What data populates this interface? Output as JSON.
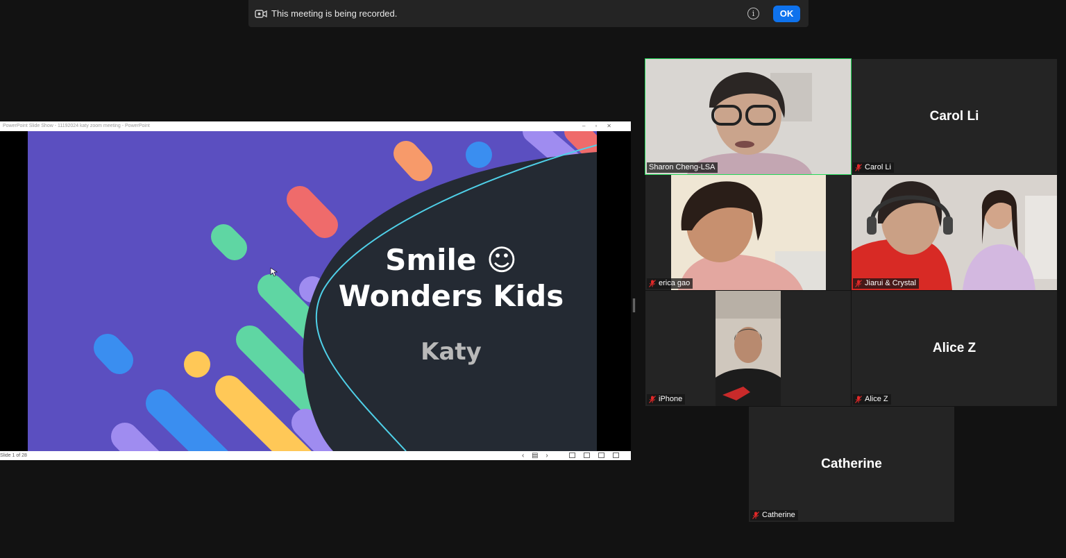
{
  "banner": {
    "message": "This meeting is being recorded.",
    "ok_label": "OK",
    "info_glyph": "i",
    "icon": "record-camera-icon"
  },
  "powerpoint": {
    "window_title": "PowerPoint Slide Show  -  11192024 katy zoom meeting - PowerPoint",
    "slide_counter": "Slide 1 of 28",
    "slide": {
      "title_line1": "Smile ☺",
      "title_line2": "Wonders Kids",
      "subtitle": "Katy"
    }
  },
  "participants": [
    {
      "name": "Sharon Cheng-LSA",
      "video": true,
      "muted": false,
      "speaking": true
    },
    {
      "name": "Carol Li",
      "display_name": "Carol Li",
      "video": false,
      "muted": true
    },
    {
      "name": "erica gao",
      "video": true,
      "muted": true
    },
    {
      "name": "Jiarui & Crystal",
      "video": true,
      "muted": true
    },
    {
      "name": "iPhone",
      "video": true,
      "muted": true
    },
    {
      "name": "Alice Z",
      "display_name": "Alice Z",
      "video": false,
      "muted": true
    },
    {
      "name": "Catherine",
      "display_name": "Catherine",
      "video": false,
      "muted": true
    }
  ],
  "colors": {
    "active_speaker": "#23d959",
    "ok_button": "#0e72ed",
    "mic_off": "#e02828",
    "slide_purple": "#5b4fc0",
    "slide_dark": "#242a33"
  }
}
